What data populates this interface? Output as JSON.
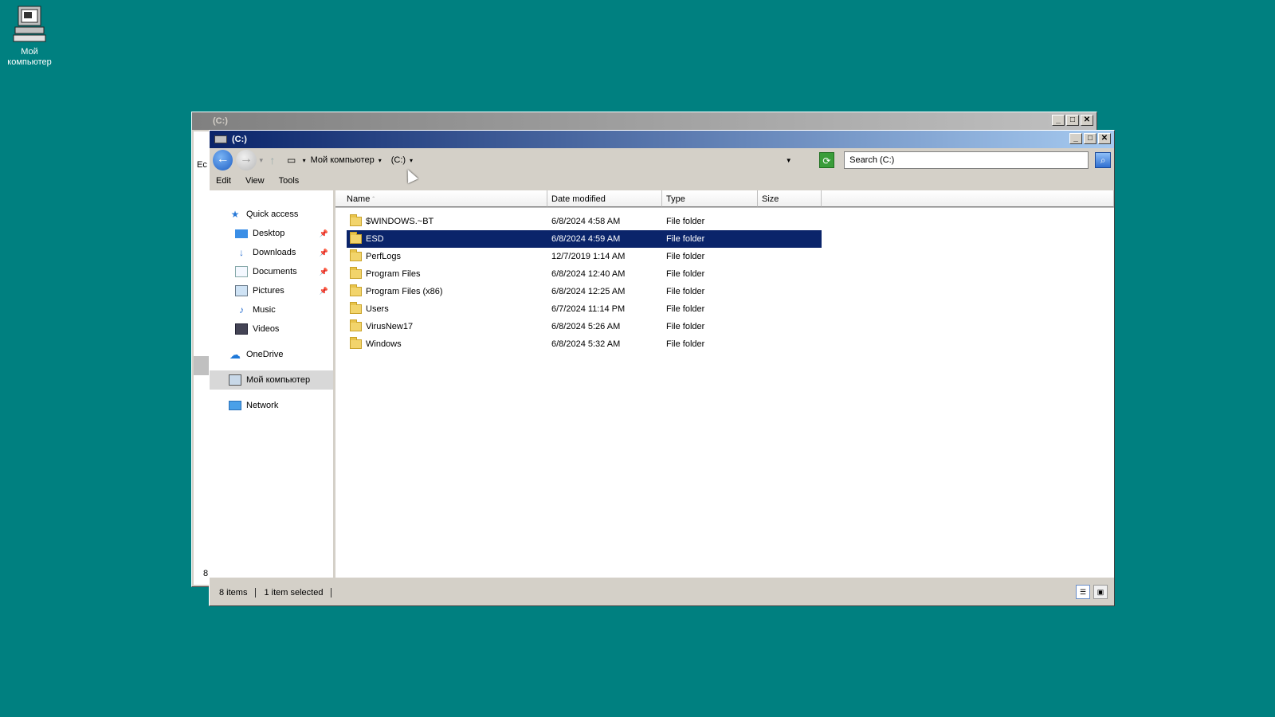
{
  "desktop": {
    "icon_label_1": "Мой",
    "icon_label_2": "компьютер"
  },
  "back_window": {
    "title": "(C:)",
    "edge_text_1": "Ec",
    "edge_text_2": "8"
  },
  "window": {
    "title": "(C:)",
    "buttons": {
      "minimize": "_",
      "maximize": "□",
      "close": "✕"
    }
  },
  "address": {
    "crumbs": [
      "Мой компьютер",
      "(C:)"
    ]
  },
  "search": {
    "placeholder": "Search  (C:)"
  },
  "menu": [
    "Edit",
    "View",
    "Tools"
  ],
  "nav": {
    "quick_access": "Quick access",
    "desktop": "Desktop",
    "downloads": "Downloads",
    "documents": "Documents",
    "pictures": "Pictures",
    "music": "Music",
    "videos": "Videos",
    "onedrive": "OneDrive",
    "my_computer": "Мой компьютер",
    "network": "Network"
  },
  "columns": {
    "name": "Name",
    "date": "Date modified",
    "type": "Type",
    "size": "Size"
  },
  "files": [
    {
      "name": "$WINDOWS.~BT",
      "date": "6/8/2024 4:58 AM",
      "type": "File folder"
    },
    {
      "name": "ESD",
      "date": "6/8/2024 4:59 AM",
      "type": "File folder"
    },
    {
      "name": "PerfLogs",
      "date": "12/7/2019 1:14 AM",
      "type": "File folder"
    },
    {
      "name": "Program Files",
      "date": "6/8/2024 12:40 AM",
      "type": "File folder"
    },
    {
      "name": "Program Files (x86)",
      "date": "6/8/2024 12:25 AM",
      "type": "File folder"
    },
    {
      "name": "Users",
      "date": "6/7/2024 11:14 PM",
      "type": "File folder"
    },
    {
      "name": "VirusNew17",
      "date": "6/8/2024 5:26 AM",
      "type": "File folder"
    },
    {
      "name": "Windows",
      "date": "6/8/2024 5:32 AM",
      "type": "File folder"
    }
  ],
  "status": {
    "items": "8 items",
    "selected": "1 item selected"
  },
  "colors": {
    "desktop": "#008080",
    "title_active": "#0a246a",
    "selection": "#0a246a"
  }
}
